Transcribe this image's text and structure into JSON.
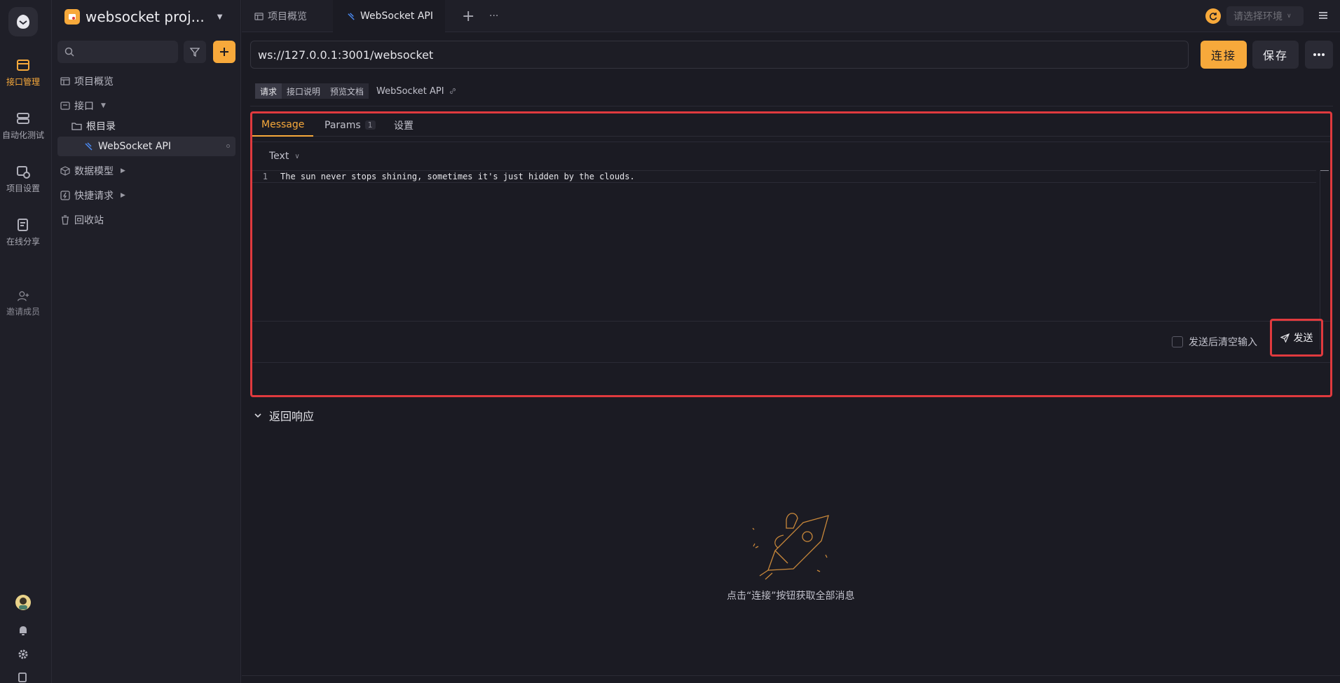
{
  "rail": {
    "items": [
      {
        "label": "接口管理",
        "icon": "api-management-icon",
        "active": true
      },
      {
        "label": "自动化测试",
        "icon": "automation-test-icon"
      },
      {
        "label": "项目设置",
        "icon": "project-settings-icon"
      },
      {
        "label": "在线分享",
        "icon": "online-share-icon"
      },
      {
        "label": "邀请成员",
        "icon": "invite-member-icon"
      }
    ]
  },
  "project": {
    "name": "websocket proj..."
  },
  "tree": {
    "overview": "项目概览",
    "interface": "接口",
    "root": "根目录",
    "api_item": "WebSocket API",
    "data_model": "数据模型",
    "quick_request": "快捷请求",
    "recycle": "回收站"
  },
  "tabs": {
    "items": [
      {
        "label": "项目概览"
      },
      {
        "label": "WebSocket API",
        "active": true
      }
    ],
    "add": "+",
    "more": "···",
    "env_placeholder": "请选择环境"
  },
  "url": {
    "value": "ws://127.0.0.1:3001/websocket"
  },
  "actions": {
    "connect": "连接",
    "save": "保存"
  },
  "subtabs": {
    "items": [
      {
        "label": "请求",
        "active": true
      },
      {
        "label": "接口说明"
      },
      {
        "label": "预览文档"
      }
    ],
    "api_name": "WebSocket API"
  },
  "message": {
    "tabs": [
      {
        "label": "Message",
        "active": true
      },
      {
        "label": "Params",
        "badge": "1"
      },
      {
        "label": "设置"
      }
    ],
    "format": "Text",
    "line_number": "1",
    "content": "The sun never stops shining, sometimes it's just hidden by the clouds.",
    "clear_after_send": "发送后清空输入",
    "send": "发送"
  },
  "response": {
    "title": "返回响应",
    "empty_hint": "点击“连接”按钮获取全部消息"
  },
  "colors": {
    "accent": "#f7a93b",
    "highlight": "#e03a3e",
    "background": "#1b1b23"
  }
}
